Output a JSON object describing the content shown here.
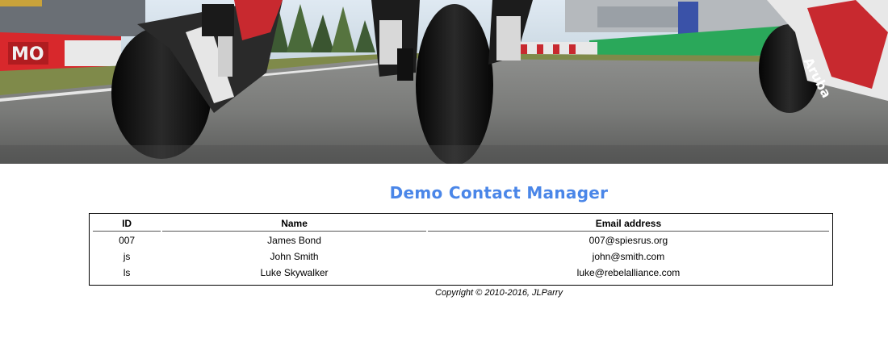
{
  "page": {
    "title": "Demo Contact Manager",
    "copyright": "Copyright © 2010-2016, JLParry",
    "accent_color": "#4a86e8"
  },
  "banner": {
    "image_name": "motorcycle-racing-banner",
    "signs": {
      "left": "MO",
      "right_bike": "Aruba"
    }
  },
  "table": {
    "columns": [
      "ID",
      "Name",
      "Email address"
    ],
    "rows": [
      [
        "007",
        "James Bond",
        "007@spiesrus.org"
      ],
      [
        "js",
        "John Smith",
        "john@smith.com"
      ],
      [
        "ls",
        "Luke Skywalker",
        "luke@rebelalliance.com"
      ]
    ]
  }
}
